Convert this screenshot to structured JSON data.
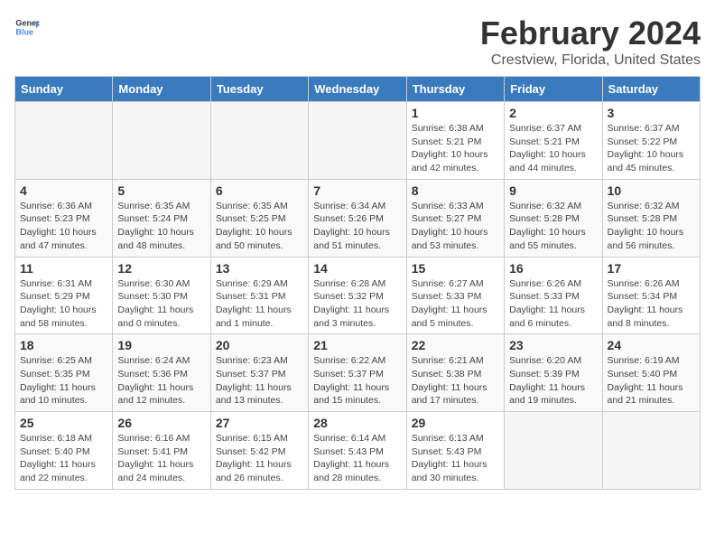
{
  "logo": {
    "line1": "General",
    "line2": "Blue"
  },
  "title": "February 2024",
  "location": "Crestview, Florida, United States",
  "weekdays": [
    "Sunday",
    "Monday",
    "Tuesday",
    "Wednesday",
    "Thursday",
    "Friday",
    "Saturday"
  ],
  "weeks": [
    [
      {
        "day": "",
        "info": ""
      },
      {
        "day": "",
        "info": ""
      },
      {
        "day": "",
        "info": ""
      },
      {
        "day": "",
        "info": ""
      },
      {
        "day": "1",
        "info": "Sunrise: 6:38 AM\nSunset: 5:21 PM\nDaylight: 10 hours\nand 42 minutes."
      },
      {
        "day": "2",
        "info": "Sunrise: 6:37 AM\nSunset: 5:21 PM\nDaylight: 10 hours\nand 44 minutes."
      },
      {
        "day": "3",
        "info": "Sunrise: 6:37 AM\nSunset: 5:22 PM\nDaylight: 10 hours\nand 45 minutes."
      }
    ],
    [
      {
        "day": "4",
        "info": "Sunrise: 6:36 AM\nSunset: 5:23 PM\nDaylight: 10 hours\nand 47 minutes."
      },
      {
        "day": "5",
        "info": "Sunrise: 6:35 AM\nSunset: 5:24 PM\nDaylight: 10 hours\nand 48 minutes."
      },
      {
        "day": "6",
        "info": "Sunrise: 6:35 AM\nSunset: 5:25 PM\nDaylight: 10 hours\nand 50 minutes."
      },
      {
        "day": "7",
        "info": "Sunrise: 6:34 AM\nSunset: 5:26 PM\nDaylight: 10 hours\nand 51 minutes."
      },
      {
        "day": "8",
        "info": "Sunrise: 6:33 AM\nSunset: 5:27 PM\nDaylight: 10 hours\nand 53 minutes."
      },
      {
        "day": "9",
        "info": "Sunrise: 6:32 AM\nSunset: 5:28 PM\nDaylight: 10 hours\nand 55 minutes."
      },
      {
        "day": "10",
        "info": "Sunrise: 6:32 AM\nSunset: 5:28 PM\nDaylight: 10 hours\nand 56 minutes."
      }
    ],
    [
      {
        "day": "11",
        "info": "Sunrise: 6:31 AM\nSunset: 5:29 PM\nDaylight: 10 hours\nand 58 minutes."
      },
      {
        "day": "12",
        "info": "Sunrise: 6:30 AM\nSunset: 5:30 PM\nDaylight: 11 hours\nand 0 minutes."
      },
      {
        "day": "13",
        "info": "Sunrise: 6:29 AM\nSunset: 5:31 PM\nDaylight: 11 hours\nand 1 minute."
      },
      {
        "day": "14",
        "info": "Sunrise: 6:28 AM\nSunset: 5:32 PM\nDaylight: 11 hours\nand 3 minutes."
      },
      {
        "day": "15",
        "info": "Sunrise: 6:27 AM\nSunset: 5:33 PM\nDaylight: 11 hours\nand 5 minutes."
      },
      {
        "day": "16",
        "info": "Sunrise: 6:26 AM\nSunset: 5:33 PM\nDaylight: 11 hours\nand 6 minutes."
      },
      {
        "day": "17",
        "info": "Sunrise: 6:26 AM\nSunset: 5:34 PM\nDaylight: 11 hours\nand 8 minutes."
      }
    ],
    [
      {
        "day": "18",
        "info": "Sunrise: 6:25 AM\nSunset: 5:35 PM\nDaylight: 11 hours\nand 10 minutes."
      },
      {
        "day": "19",
        "info": "Sunrise: 6:24 AM\nSunset: 5:36 PM\nDaylight: 11 hours\nand 12 minutes."
      },
      {
        "day": "20",
        "info": "Sunrise: 6:23 AM\nSunset: 5:37 PM\nDaylight: 11 hours\nand 13 minutes."
      },
      {
        "day": "21",
        "info": "Sunrise: 6:22 AM\nSunset: 5:37 PM\nDaylight: 11 hours\nand 15 minutes."
      },
      {
        "day": "22",
        "info": "Sunrise: 6:21 AM\nSunset: 5:38 PM\nDaylight: 11 hours\nand 17 minutes."
      },
      {
        "day": "23",
        "info": "Sunrise: 6:20 AM\nSunset: 5:39 PM\nDaylight: 11 hours\nand 19 minutes."
      },
      {
        "day": "24",
        "info": "Sunrise: 6:19 AM\nSunset: 5:40 PM\nDaylight: 11 hours\nand 21 minutes."
      }
    ],
    [
      {
        "day": "25",
        "info": "Sunrise: 6:18 AM\nSunset: 5:40 PM\nDaylight: 11 hours\nand 22 minutes."
      },
      {
        "day": "26",
        "info": "Sunrise: 6:16 AM\nSunset: 5:41 PM\nDaylight: 11 hours\nand 24 minutes."
      },
      {
        "day": "27",
        "info": "Sunrise: 6:15 AM\nSunset: 5:42 PM\nDaylight: 11 hours\nand 26 minutes."
      },
      {
        "day": "28",
        "info": "Sunrise: 6:14 AM\nSunset: 5:43 PM\nDaylight: 11 hours\nand 28 minutes."
      },
      {
        "day": "29",
        "info": "Sunrise: 6:13 AM\nSunset: 5:43 PM\nDaylight: 11 hours\nand 30 minutes."
      },
      {
        "day": "",
        "info": ""
      },
      {
        "day": "",
        "info": ""
      }
    ]
  ]
}
